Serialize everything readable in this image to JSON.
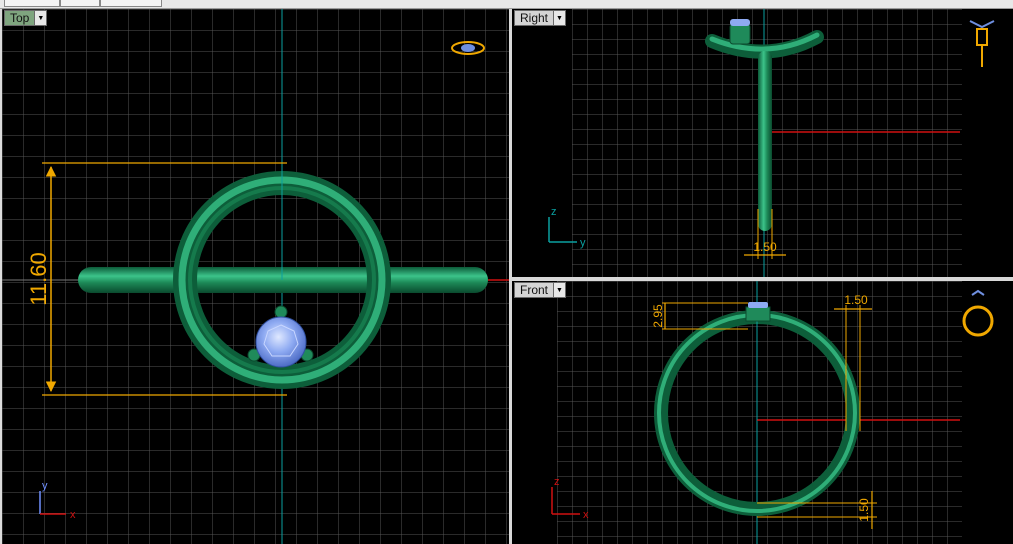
{
  "viewports": {
    "top": {
      "name": "Top",
      "dimension": "11.60",
      "axis_x": "x",
      "axis_y": "y",
      "view_icon": "ring-view-icon"
    },
    "right": {
      "name": "Right",
      "dimension": "1.50",
      "axis_z": "z",
      "axis_y": "y",
      "view_icon": "ring-side-view-icon"
    },
    "front": {
      "name": "Front",
      "dim_top": "2.95",
      "dim_width": "1.50",
      "dim_bottom": "1.50",
      "axis_z": "z",
      "axis_x": "x",
      "view_icon": "ring-front-view-icon"
    }
  },
  "colors": {
    "background": "#000000",
    "grid": "#4a4a4a",
    "grid_major": "#6e6e6e",
    "ring": "#1f8a5a",
    "gem": "#7ea0f0",
    "dimension": "#f0a800",
    "axis_x": "#d01010",
    "axis_y": "#0aa0a0",
    "active_label": "#7fa57f"
  }
}
